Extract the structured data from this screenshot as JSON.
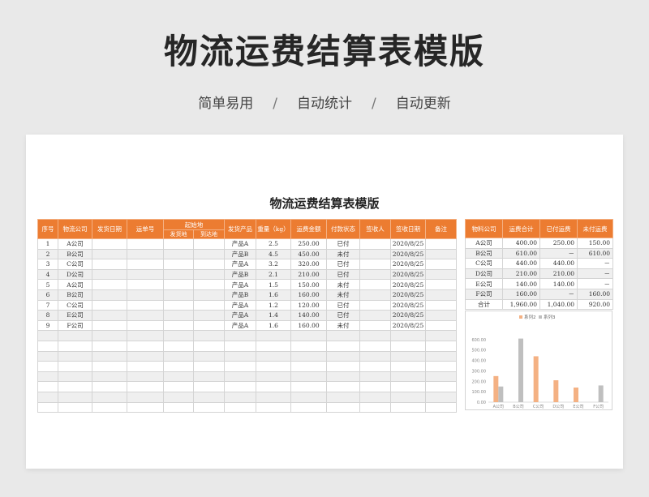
{
  "hero": {
    "title": "物流运费结算表模版",
    "tags": [
      "简单易用",
      "自动统计",
      "自动更新"
    ],
    "separator": "/"
  },
  "sheet": {
    "title": "物流运费结算表模版",
    "headers": {
      "seq": "序号",
      "company": "物流公司",
      "ship_date": "发货日期",
      "waybill": "运单号",
      "origin_dest": "起始地",
      "origin": "发货地",
      "dest": "到达地",
      "product": "发货产品",
      "weight": "重量（kg）",
      "amount": "运费金额",
      "status": "付款状态",
      "receiver": "签收人",
      "sign_date": "签收日期",
      "remark": "备注"
    },
    "rows": [
      {
        "seq": "1",
        "company": "A公司",
        "product": "产品A",
        "weight": "2.5",
        "amount": "250.00",
        "status": "已付",
        "sign_date": "2020/8/25"
      },
      {
        "seq": "2",
        "company": "B公司",
        "product": "产品B",
        "weight": "4.5",
        "amount": "450.00",
        "status": "未付",
        "sign_date": "2020/8/25"
      },
      {
        "seq": "3",
        "company": "C公司",
        "product": "产品A",
        "weight": "3.2",
        "amount": "320.00",
        "status": "已付",
        "sign_date": "2020/8/25"
      },
      {
        "seq": "4",
        "company": "D公司",
        "product": "产品B",
        "weight": "2.1",
        "amount": "210.00",
        "status": "已付",
        "sign_date": "2020/8/25"
      },
      {
        "seq": "5",
        "company": "A公司",
        "product": "产品A",
        "weight": "1.5",
        "amount": "150.00",
        "status": "未付",
        "sign_date": "2020/8/25"
      },
      {
        "seq": "6",
        "company": "B公司",
        "product": "产品B",
        "weight": "1.6",
        "amount": "160.00",
        "status": "未付",
        "sign_date": "2020/8/25"
      },
      {
        "seq": "7",
        "company": "C公司",
        "product": "产品A",
        "weight": "1.2",
        "amount": "120.00",
        "status": "已付",
        "sign_date": "2020/8/25"
      },
      {
        "seq": "8",
        "company": "E公司",
        "product": "产品A",
        "weight": "1.4",
        "amount": "140.00",
        "status": "已付",
        "sign_date": "2020/8/25"
      },
      {
        "seq": "9",
        "company": "F公司",
        "product": "产品A",
        "weight": "1.6",
        "amount": "160.00",
        "status": "未付",
        "sign_date": "2020/8/25"
      }
    ],
    "empty_rows": 8
  },
  "summary": {
    "headers": {
      "company": "物料公司",
      "total": "运费合计",
      "paid": "已付运费",
      "unpaid": "未付运费"
    },
    "rows": [
      {
        "company": "A公司",
        "total": "400.00",
        "paid": "250.00",
        "unpaid": "150.00"
      },
      {
        "company": "B公司",
        "total": "610.00",
        "paid": "－",
        "unpaid": "610.00"
      },
      {
        "company": "C公司",
        "total": "440.00",
        "paid": "440.00",
        "unpaid": "－"
      },
      {
        "company": "D公司",
        "total": "210.00",
        "paid": "210.00",
        "unpaid": "－"
      },
      {
        "company": "E公司",
        "total": "140.00",
        "paid": "140.00",
        "unpaid": "－"
      },
      {
        "company": "F公司",
        "total": "160.00",
        "paid": "－",
        "unpaid": "160.00"
      },
      {
        "company": "合计",
        "total": "1,960.00",
        "paid": "1,040.00",
        "unpaid": "920.00"
      }
    ]
  },
  "chart_data": {
    "type": "bar",
    "categories": [
      "A公司",
      "B公司",
      "C公司",
      "D公司",
      "E公司",
      "F公司"
    ],
    "series": [
      {
        "name": "系列2",
        "color": "#f4b183",
        "values": [
          250,
          0,
          440,
          210,
          140,
          0
        ]
      },
      {
        "name": "系列3",
        "color": "#bfbfbf",
        "values": [
          150,
          610,
          0,
          0,
          0,
          160
        ]
      }
    ],
    "y_ticks": [
      "0.00",
      "100.00",
      "200.00",
      "300.00",
      "400.00",
      "500.00",
      "600.00"
    ],
    "ylim": [
      0,
      700
    ],
    "legend_position": "top",
    "grid": false
  }
}
